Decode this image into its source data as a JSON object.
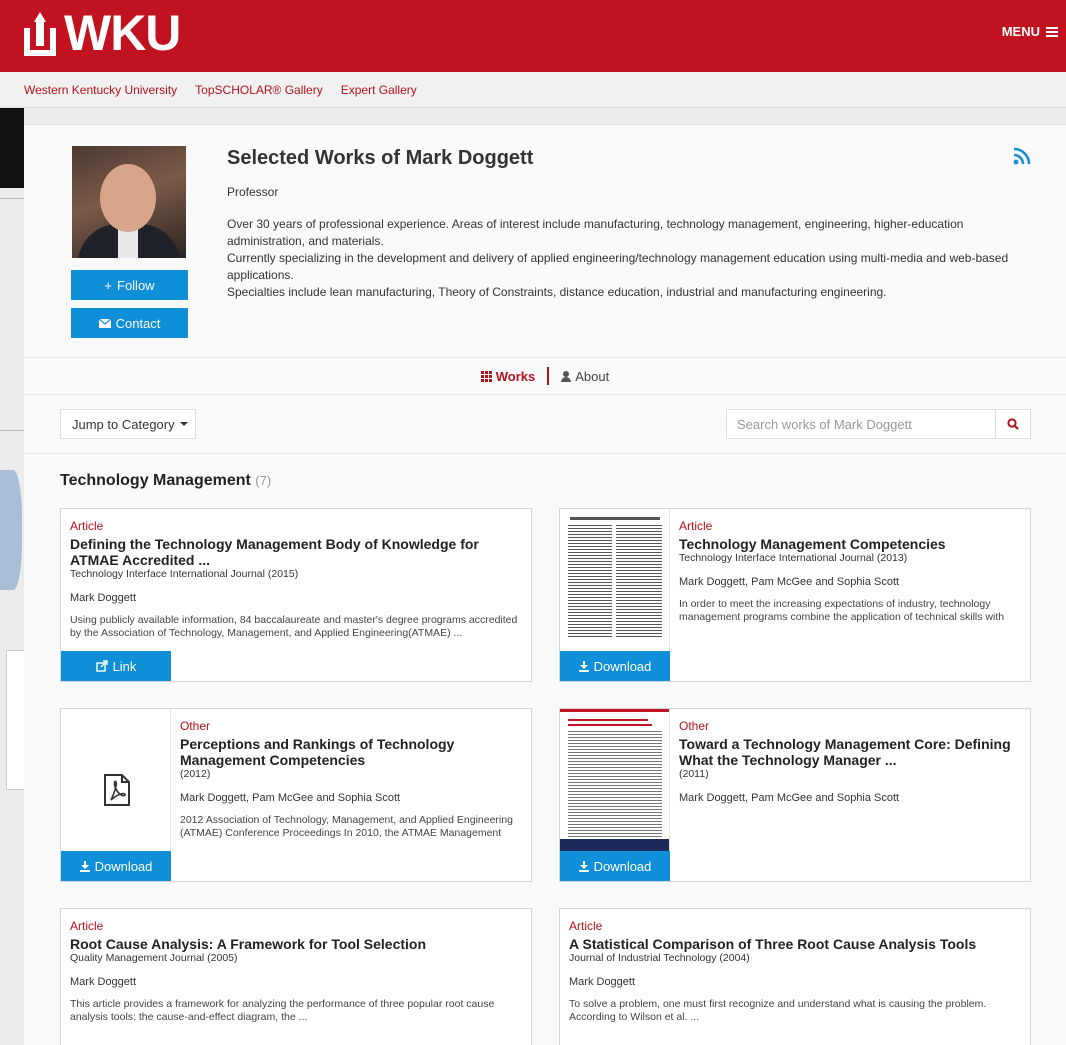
{
  "header": {
    "logo_text": "WKU",
    "menu_label": "MENU"
  },
  "crumbs": [
    "Western Kentucky University",
    "TopSCHOLAR® Gallery",
    "Expert Gallery"
  ],
  "profile": {
    "title": "Selected Works of Mark Doggett",
    "role": "Professor",
    "bio": [
      "Over 30 years of professional experience. Areas of interest include manufacturing, technology management, engineering, higher-education administration, and materials.",
      "Currently specializing in the development and delivery of applied engineering/technology management education using multi-media and web-based applications.",
      "Specialties include lean manufacturing, Theory of Constraints, distance education, industrial and manufacturing engineering."
    ],
    "follow_label": "Follow",
    "contact_label": "Contact"
  },
  "tabs": {
    "works": "Works",
    "about": "About"
  },
  "toolbar": {
    "jump_label": "Jump to Category",
    "search_placeholder": "Search works of Mark Doggett"
  },
  "category": {
    "name": "Technology Management",
    "count": "(7)"
  },
  "works": [
    {
      "type": "Article",
      "title": "Defining the Technology Management Body of Knowledge for ATMAE Accredited ...",
      "source": "Technology Interface International Journal (2015)",
      "authors": "Mark Doggett",
      "abstract": "Using publicly available information, 84 baccalaureate and master's degree programs accredited by the Association of Technology, Management, and Applied Engineering(ATMAE) ...",
      "action": "Link",
      "thumb": "none"
    },
    {
      "type": "Article",
      "title": "Technology Management Competencies",
      "source": "Technology Interface International Journal (2013)",
      "authors": "Mark Doggett, Pam McGee and Sophia Scott",
      "abstract": "In order to meet the increasing expectations of industry, technology management programs combine the application of technical skills with",
      "action": "Download",
      "thumb": "document"
    },
    {
      "type": "Other",
      "title": "Perceptions and Rankings of Technology Management Competencies",
      "source": "(2012)",
      "authors": "Mark Doggett, Pam McGee and Sophia Scott",
      "abstract": "2012 Association of Technology, Management, and Applied Engineering (ATMAE) Conference Proceedings In 2010, the ATMAE Management",
      "action": "Download",
      "thumb": "pdf-icon"
    },
    {
      "type": "Other",
      "title": "Toward a Technology Management Core: Defining What the Technology Manager ...",
      "source": "(2011)",
      "authors": "Mark Doggett, Pam McGee and Sophia Scott",
      "abstract": "",
      "action": "Download",
      "thumb": "document"
    },
    {
      "type": "Article",
      "title": "Root Cause Analysis: A Framework for Tool Selection",
      "source": "Quality Management Journal (2005)",
      "authors": "Mark Doggett",
      "abstract": "This article provides a framework for analyzing the performance of three popular root cause analysis tools: the cause-and-effect diagram, the ...",
      "action": "",
      "thumb": "none"
    },
    {
      "type": "Article",
      "title": "A Statistical Comparison of Three Root Cause Analysis Tools",
      "source": "Journal of Industrial Technology (2004)",
      "authors": "Mark Doggett",
      "abstract": "To solve a problem, one must first recognize and understand what is causing the problem. According to Wilson et al. ...",
      "action": "",
      "thumb": "none"
    }
  ],
  "colors": {
    "brand_red": "#c1121f",
    "link_red": "#b5121b",
    "button_blue": "#0f8fd7",
    "rss_blue": "#1a8fd6"
  }
}
